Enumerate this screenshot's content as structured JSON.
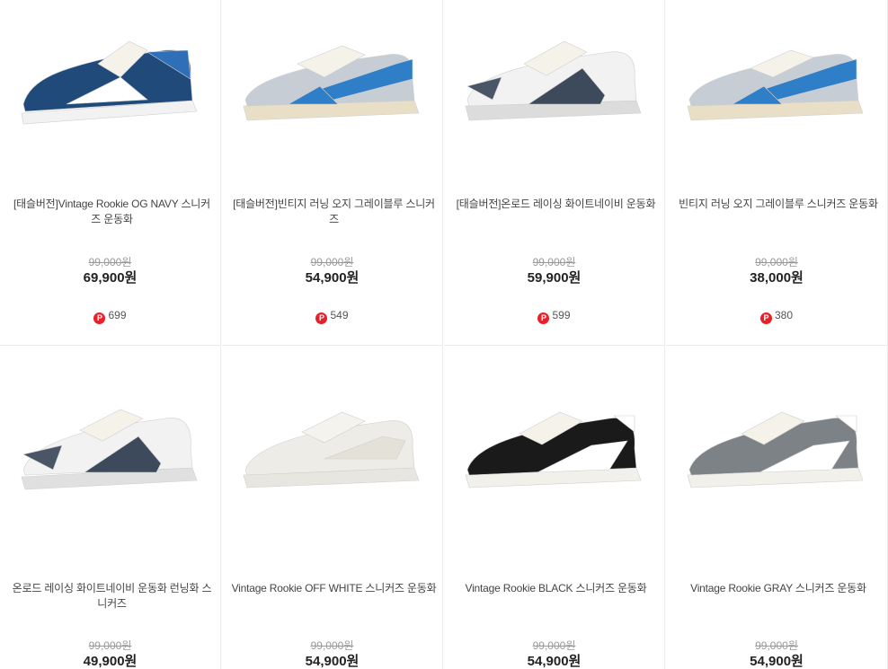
{
  "currency_suffix": "원",
  "point_symbol": "P",
  "products": [
    {
      "name": "[태슬버전]Vintage Rookie OG NAVY 스니커즈 운동화",
      "original_price": "99,000원",
      "sale_price": "69,900원",
      "points": "699",
      "colors": {
        "upper": "#1f4a7a",
        "stripe": "#ffffff",
        "accent": "#2f6fb8",
        "sole": "#f2f2f2",
        "lace": "#f5f2ea"
      }
    },
    {
      "name": "[태슬버전]빈티지 러닝 오지 그레이블루 스니커즈",
      "original_price": "99,000원",
      "sale_price": "54,900원",
      "points": "549",
      "colors": {
        "upper": "#c7cdd4",
        "stripe": "#2f7fc8",
        "accent": "#2f7fc8",
        "sole": "#e9dfc6",
        "lace": "#f5f2ea"
      }
    },
    {
      "name": "[태슬버전]온로드 레이싱 화이트네이비 운동화",
      "original_price": "99,000원",
      "sale_price": "59,900원",
      "points": "599",
      "colors": {
        "upper": "#f2f2f2",
        "stripe": "#3d4a5c",
        "accent": "#4a5566",
        "sole": "#dcdcdc",
        "lace": "#f5f2ea"
      }
    },
    {
      "name": "빈티지 러닝 오지 그레이블루 스니커즈 운동화",
      "original_price": "99,000원",
      "sale_price": "38,000원",
      "points": "380",
      "colors": {
        "upper": "#c7cdd4",
        "stripe": "#2f7fc8",
        "accent": "#2f7fc8",
        "sole": "#e9dfc6",
        "lace": "#f5f2ea"
      }
    },
    {
      "name": "온로드 레이싱 화이트네이비 운동화 런닝화 스니커즈",
      "original_price": "99,000원",
      "sale_price": "49,900원",
      "points": "",
      "colors": {
        "upper": "#f2f2f2",
        "stripe": "#3d4a5c",
        "accent": "#4a5566",
        "sole": "#e0e0e0",
        "lace": "#f5f2ea"
      }
    },
    {
      "name": "Vintage Rookie OFF WHITE 스니커즈 운동화",
      "original_price": "99,000원",
      "sale_price": "54,900원",
      "points": "",
      "colors": {
        "upper": "#eeece6",
        "stripe": "#e4e1d9",
        "accent": "#dcd9d0",
        "sole": "#e8e6e0",
        "lace": "#f5f3ee"
      }
    },
    {
      "name": "Vintage Rookie BLACK 스니커즈 운동화",
      "original_price": "99,000원",
      "sale_price": "54,900원",
      "points": "",
      "colors": {
        "upper": "#1a1a1a",
        "stripe": "#ffffff",
        "accent": "#ffffff",
        "sole": "#f2f0ea",
        "lace": "#f5f2ea"
      }
    },
    {
      "name": "Vintage Rookie GRAY 스니커즈 운동화",
      "original_price": "99,000원",
      "sale_price": "54,900원",
      "points": "",
      "colors": {
        "upper": "#7d8286",
        "stripe": "#ffffff",
        "accent": "#ffffff",
        "sole": "#f2f0ea",
        "lace": "#f5f2ea"
      }
    }
  ]
}
